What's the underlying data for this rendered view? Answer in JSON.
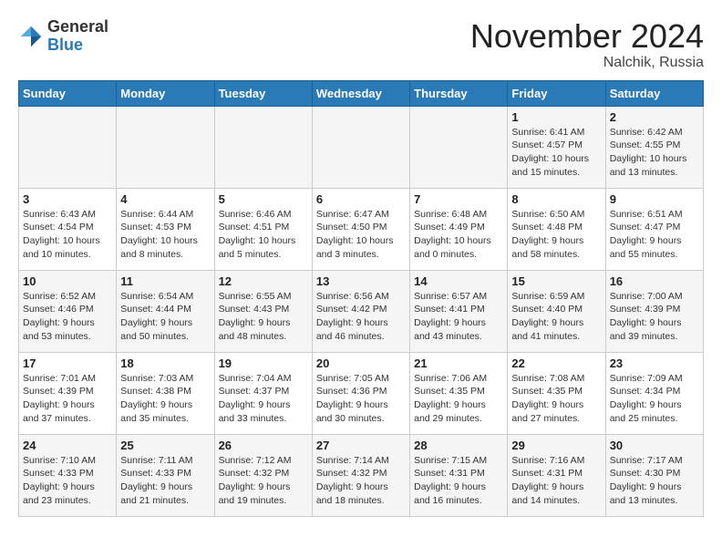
{
  "header": {
    "logo_line1": "General",
    "logo_line2": "Blue",
    "month": "November 2024",
    "location": "Nalchik, Russia"
  },
  "weekdays": [
    "Sunday",
    "Monday",
    "Tuesday",
    "Wednesday",
    "Thursday",
    "Friday",
    "Saturday"
  ],
  "weeks": [
    [
      {
        "day": "",
        "info": ""
      },
      {
        "day": "",
        "info": ""
      },
      {
        "day": "",
        "info": ""
      },
      {
        "day": "",
        "info": ""
      },
      {
        "day": "",
        "info": ""
      },
      {
        "day": "1",
        "info": "Sunrise: 6:41 AM\nSunset: 4:57 PM\nDaylight: 10 hours\nand 15 minutes."
      },
      {
        "day": "2",
        "info": "Sunrise: 6:42 AM\nSunset: 4:55 PM\nDaylight: 10 hours\nand 13 minutes."
      }
    ],
    [
      {
        "day": "3",
        "info": "Sunrise: 6:43 AM\nSunset: 4:54 PM\nDaylight: 10 hours\nand 10 minutes."
      },
      {
        "day": "4",
        "info": "Sunrise: 6:44 AM\nSunset: 4:53 PM\nDaylight: 10 hours\nand 8 minutes."
      },
      {
        "day": "5",
        "info": "Sunrise: 6:46 AM\nSunset: 4:51 PM\nDaylight: 10 hours\nand 5 minutes."
      },
      {
        "day": "6",
        "info": "Sunrise: 6:47 AM\nSunset: 4:50 PM\nDaylight: 10 hours\nand 3 minutes."
      },
      {
        "day": "7",
        "info": "Sunrise: 6:48 AM\nSunset: 4:49 PM\nDaylight: 10 hours\nand 0 minutes."
      },
      {
        "day": "8",
        "info": "Sunrise: 6:50 AM\nSunset: 4:48 PM\nDaylight: 9 hours\nand 58 minutes."
      },
      {
        "day": "9",
        "info": "Sunrise: 6:51 AM\nSunset: 4:47 PM\nDaylight: 9 hours\nand 55 minutes."
      }
    ],
    [
      {
        "day": "10",
        "info": "Sunrise: 6:52 AM\nSunset: 4:46 PM\nDaylight: 9 hours\nand 53 minutes."
      },
      {
        "day": "11",
        "info": "Sunrise: 6:54 AM\nSunset: 4:44 PM\nDaylight: 9 hours\nand 50 minutes."
      },
      {
        "day": "12",
        "info": "Sunrise: 6:55 AM\nSunset: 4:43 PM\nDaylight: 9 hours\nand 48 minutes."
      },
      {
        "day": "13",
        "info": "Sunrise: 6:56 AM\nSunset: 4:42 PM\nDaylight: 9 hours\nand 46 minutes."
      },
      {
        "day": "14",
        "info": "Sunrise: 6:57 AM\nSunset: 4:41 PM\nDaylight: 9 hours\nand 43 minutes."
      },
      {
        "day": "15",
        "info": "Sunrise: 6:59 AM\nSunset: 4:40 PM\nDaylight: 9 hours\nand 41 minutes."
      },
      {
        "day": "16",
        "info": "Sunrise: 7:00 AM\nSunset: 4:39 PM\nDaylight: 9 hours\nand 39 minutes."
      }
    ],
    [
      {
        "day": "17",
        "info": "Sunrise: 7:01 AM\nSunset: 4:39 PM\nDaylight: 9 hours\nand 37 minutes."
      },
      {
        "day": "18",
        "info": "Sunrise: 7:03 AM\nSunset: 4:38 PM\nDaylight: 9 hours\nand 35 minutes."
      },
      {
        "day": "19",
        "info": "Sunrise: 7:04 AM\nSunset: 4:37 PM\nDaylight: 9 hours\nand 33 minutes."
      },
      {
        "day": "20",
        "info": "Sunrise: 7:05 AM\nSunset: 4:36 PM\nDaylight: 9 hours\nand 30 minutes."
      },
      {
        "day": "21",
        "info": "Sunrise: 7:06 AM\nSunset: 4:35 PM\nDaylight: 9 hours\nand 29 minutes."
      },
      {
        "day": "22",
        "info": "Sunrise: 7:08 AM\nSunset: 4:35 PM\nDaylight: 9 hours\nand 27 minutes."
      },
      {
        "day": "23",
        "info": "Sunrise: 7:09 AM\nSunset: 4:34 PM\nDaylight: 9 hours\nand 25 minutes."
      }
    ],
    [
      {
        "day": "24",
        "info": "Sunrise: 7:10 AM\nSunset: 4:33 PM\nDaylight: 9 hours\nand 23 minutes."
      },
      {
        "day": "25",
        "info": "Sunrise: 7:11 AM\nSunset: 4:33 PM\nDaylight: 9 hours\nand 21 minutes."
      },
      {
        "day": "26",
        "info": "Sunrise: 7:12 AM\nSunset: 4:32 PM\nDaylight: 9 hours\nand 19 minutes."
      },
      {
        "day": "27",
        "info": "Sunrise: 7:14 AM\nSunset: 4:32 PM\nDaylight: 9 hours\nand 18 minutes."
      },
      {
        "day": "28",
        "info": "Sunrise: 7:15 AM\nSunset: 4:31 PM\nDaylight: 9 hours\nand 16 minutes."
      },
      {
        "day": "29",
        "info": "Sunrise: 7:16 AM\nSunset: 4:31 PM\nDaylight: 9 hours\nand 14 minutes."
      },
      {
        "day": "30",
        "info": "Sunrise: 7:17 AM\nSunset: 4:30 PM\nDaylight: 9 hours\nand 13 minutes."
      }
    ]
  ]
}
